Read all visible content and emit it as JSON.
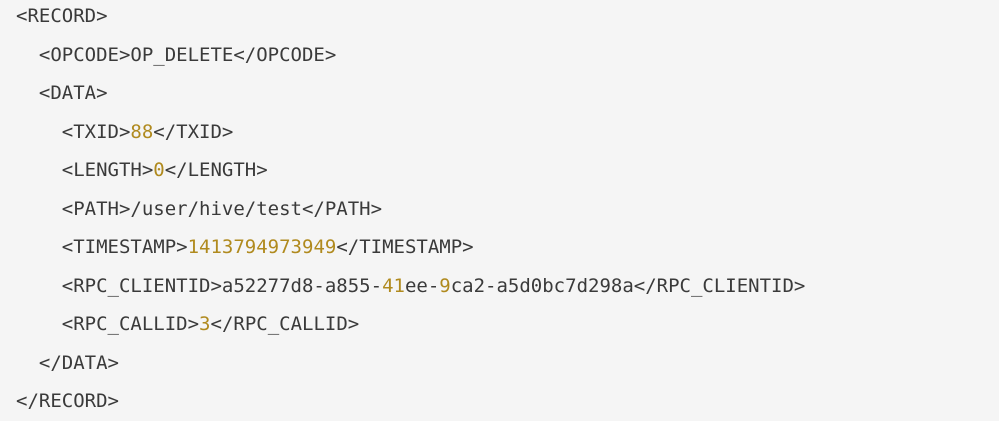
{
  "code": {
    "lines": [
      {
        "indent": "",
        "segments": [
          {
            "text": "<RECORD>",
            "type": "text"
          }
        ]
      },
      {
        "indent": "  ",
        "segments": [
          {
            "text": "<OPCODE>OP_DELETE</OPCODE>",
            "type": "text"
          }
        ]
      },
      {
        "indent": "  ",
        "segments": [
          {
            "text": "<DATA>",
            "type": "text"
          }
        ]
      },
      {
        "indent": "    ",
        "segments": [
          {
            "text": "<TXID>",
            "type": "text"
          },
          {
            "text": "88",
            "type": "num"
          },
          {
            "text": "</TXID>",
            "type": "text"
          }
        ]
      },
      {
        "indent": "    ",
        "segments": [
          {
            "text": "<LENGTH>",
            "type": "text"
          },
          {
            "text": "0",
            "type": "num"
          },
          {
            "text": "</LENGTH>",
            "type": "text"
          }
        ]
      },
      {
        "indent": "    ",
        "segments": [
          {
            "text": "<PATH>/user/hive/test</PATH>",
            "type": "text"
          }
        ]
      },
      {
        "indent": "    ",
        "segments": [
          {
            "text": "<TIMESTAMP>",
            "type": "text"
          },
          {
            "text": "1413794973949",
            "type": "num"
          },
          {
            "text": "</TIMESTAMP>",
            "type": "text"
          }
        ]
      },
      {
        "indent": "    ",
        "segments": [
          {
            "text": "<RPC_CLIENTID>a52277d8-a855-",
            "type": "text"
          },
          {
            "text": "41",
            "type": "num"
          },
          {
            "text": "ee-",
            "type": "text"
          },
          {
            "text": "9",
            "type": "num"
          },
          {
            "text": "ca2-a5d0bc7d298a</RPC_CLIENTID>",
            "type": "text"
          }
        ]
      },
      {
        "indent": "    ",
        "segments": [
          {
            "text": "<RPC_CALLID>",
            "type": "text"
          },
          {
            "text": "3",
            "type": "num"
          },
          {
            "text": "</RPC_CALLID>",
            "type": "text"
          }
        ]
      },
      {
        "indent": "  ",
        "segments": [
          {
            "text": "</DATA>",
            "type": "text"
          }
        ]
      },
      {
        "indent": "",
        "segments": [
          {
            "text": "</RECORD>",
            "type": "text"
          }
        ]
      }
    ],
    "colors": {
      "text": "#3a3a3a",
      "number": "#b08a1e",
      "background": "#f5f5f5"
    }
  }
}
